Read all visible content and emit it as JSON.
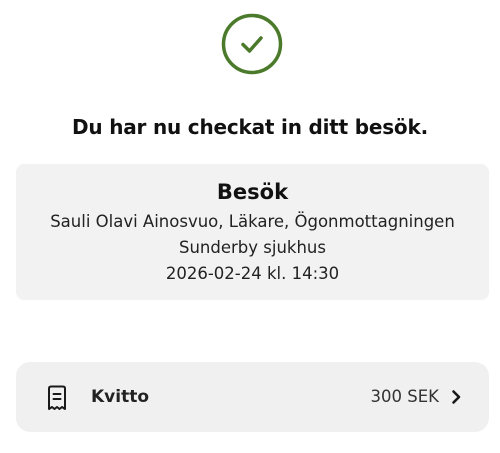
{
  "success": {
    "icon": "check-circle-icon",
    "color": "#4a7a2a"
  },
  "headline": "Du har nu checkat in ditt besök.",
  "visit": {
    "title": "Besök",
    "details": "Sauli Olavi Ainosvuo, Läkare, Ögonmottagningen",
    "location": "Sunderby sjukhus",
    "datetime": "2026-02-24 kl. 14:30"
  },
  "receipt": {
    "icon": "receipt-icon",
    "label": "Kvitto",
    "amount": "300 SEK",
    "chevron": "chevron-right-icon"
  }
}
